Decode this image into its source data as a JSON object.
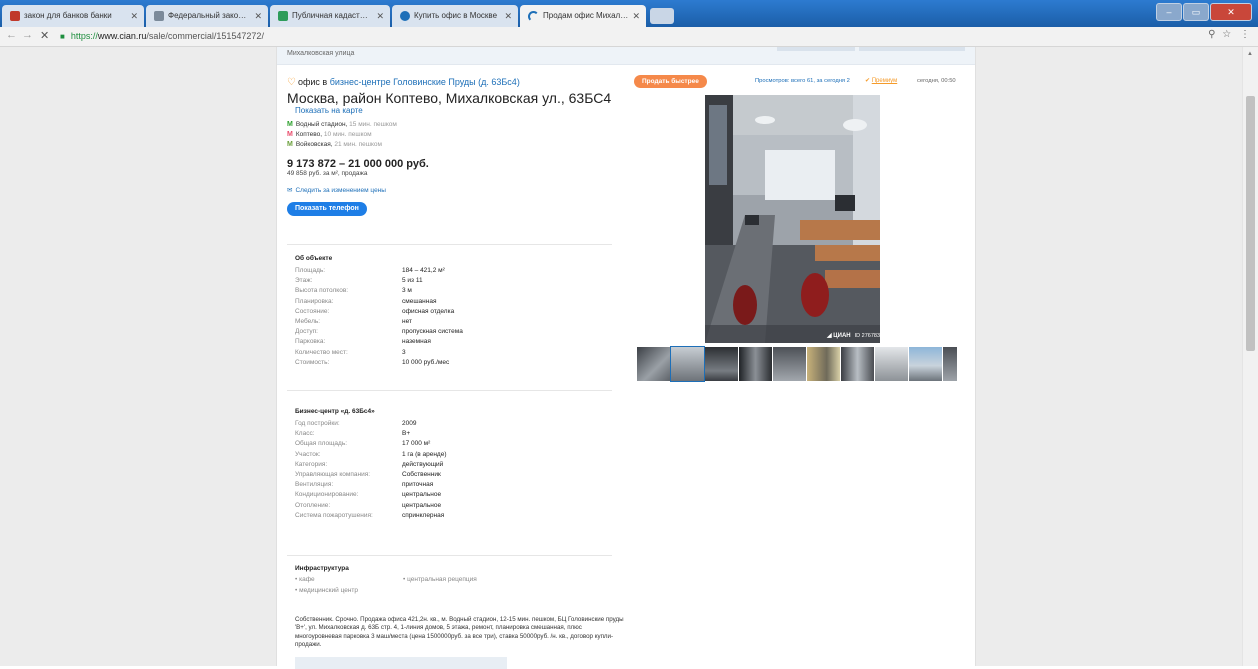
{
  "browser": {
    "tabs": [
      {
        "title": "закон для банков банки"
      },
      {
        "title": "Федеральный закон \"О"
      },
      {
        "title": "Публичная кадастровая"
      },
      {
        "title": "Купить офис в Москве"
      },
      {
        "title": "Продам офис Михалков"
      }
    ],
    "url_scheme": "https://",
    "url_host": "www.cian.ru",
    "url_path": "/sale/commercial/151547272/"
  },
  "breadcrumb": "Михалковская улица",
  "listing": {
    "heading_prefix": "офис в",
    "heading_link": "бизнес-центре Головинские Пруды (д. 63Бс4)",
    "address": "Москва, район Коптево, Михалковская ул., 63БС4",
    "show_map": "Показать на карте",
    "metro": [
      {
        "station": "Водный стадион,",
        "time": "15 мин. пешком"
      },
      {
        "station": "Коптево,",
        "time": "10 мин. пешком"
      },
      {
        "station": "Войковская,",
        "time": "21 мин. пешком"
      }
    ],
    "price": "9 173 872 – 21 000 000 руб.",
    "price_per_m2": "49 858 руб. за м², продажа",
    "follow_price": "Следить за изменением цены",
    "phone_button": "Показать телефон"
  },
  "about": {
    "title": "Об объекте",
    "rows": [
      {
        "k": "Площадь:",
        "v": "184 – 421,2 м²"
      },
      {
        "k": "Этаж:",
        "v": "5 из 11"
      },
      {
        "k": "Высота потолков:",
        "v": "3 м"
      },
      {
        "k": "Планировка:",
        "v": "смешанная"
      },
      {
        "k": "Состояние:",
        "v": "офисная отделка"
      },
      {
        "k": "Мебель:",
        "v": "нет"
      },
      {
        "k": "Доступ:",
        "v": "пропускная система"
      },
      {
        "k": "Парковка:",
        "v": "наземная"
      },
      {
        "k": "Количество мест:",
        "v": "3"
      },
      {
        "k": "Стоимость:",
        "v": "10 000 руб./мес"
      }
    ]
  },
  "bc": {
    "title": "Бизнес-центр «д. 63Бс4»",
    "rows": [
      {
        "k": "Год постройки:",
        "v": "2009"
      },
      {
        "k": "Класс:",
        "v": "B+"
      },
      {
        "k": "Общая площадь:",
        "v": "17 000 м²"
      },
      {
        "k": "Участок:",
        "v": "1 га (в аренде)"
      },
      {
        "k": "Категория:",
        "v": "действующий"
      },
      {
        "k": "Управляющая компания:",
        "v": "Собственник"
      },
      {
        "k": "Вентиляция:",
        "v": "приточная"
      },
      {
        "k": "Кондиционирование:",
        "v": "центральное"
      },
      {
        "k": "Отопление:",
        "v": "центральное"
      },
      {
        "k": "Система пожаротушения:",
        "v": "спринклерная"
      }
    ]
  },
  "infra": {
    "title": "Инфраструктура",
    "items": [
      "кафе",
      "центральная рецепция",
      "медицинский центр"
    ]
  },
  "description": "Собственник. Срочно. Продажа офиса 421,2н. кв., м. Водный стадион, 12-15 мин. пешком, БЦ Головинские пруды 'В+', ул. Михалковская д. 63Б стр. 4, 1-линия домов, 5 этажа, ремонт, планировка смешанная, плюс многоуровневая парковка 3 маш/места (цена 1500000руб. за все три), ставка 50000руб. /н. кв., договор купли-продажи.",
  "right": {
    "sell_fast": "Продать быстрее",
    "views": "Просмотров: всего 61, за сегодня 2",
    "premium": "Премиум",
    "today": "сегодня, 00:50",
    "watermark_brand": "ЦИАН",
    "watermark_id": "ID 276783"
  },
  "colors": {
    "accent": "#1e7ee6",
    "orange": "#f5894a",
    "link": "#1d6fb8"
  }
}
